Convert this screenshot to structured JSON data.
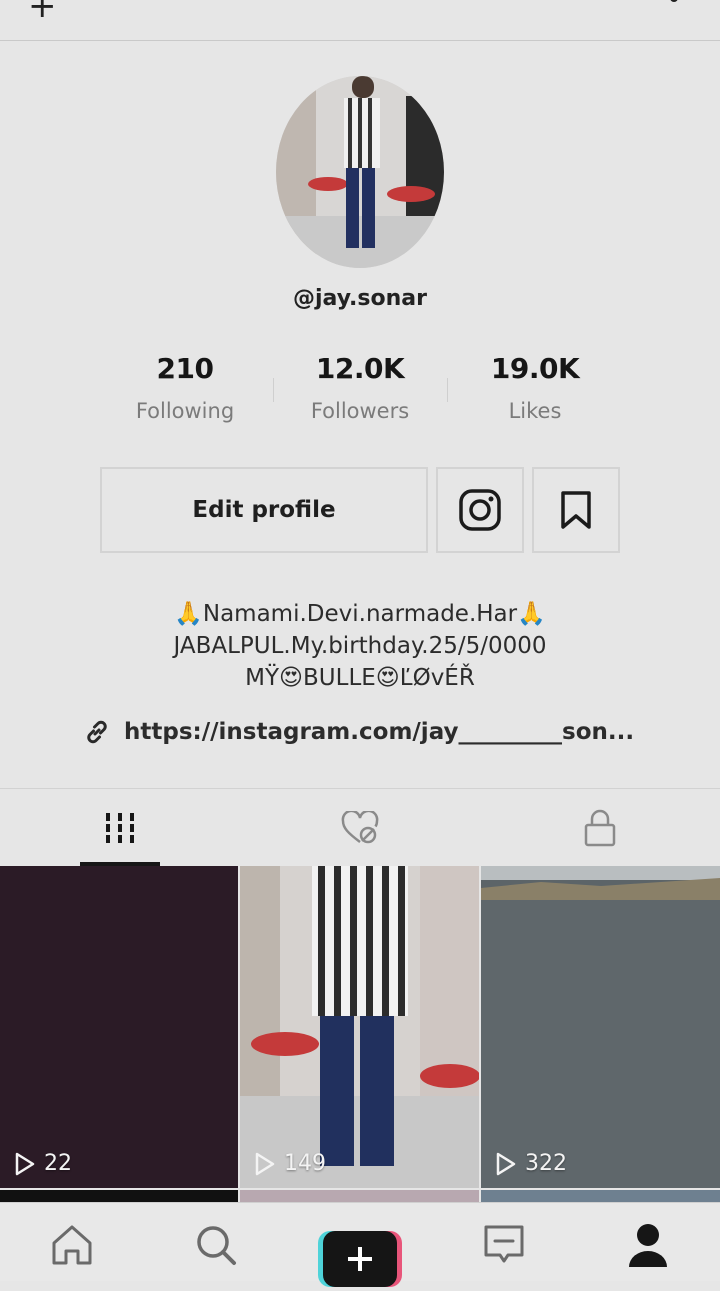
{
  "profile": {
    "username": "@jay.sonar",
    "stats": [
      {
        "value": "210",
        "label": "Following"
      },
      {
        "value": "12.0K",
        "label": "Followers"
      },
      {
        "value": "19.0K",
        "label": "Likes"
      }
    ],
    "edit_label": "Edit profile",
    "bio_lines": [
      "🙏Namami.Devi.narmade.Har🙏",
      "JABALPUL.My.birthday.25/5/0000",
      "MŸ😍BULLE😍ĽØvÉŘ"
    ],
    "link": "https://instagram.com/jay_________son..."
  },
  "tabs": [
    {
      "name": "videos",
      "icon": "grid-icon",
      "active": true
    },
    {
      "name": "liked",
      "icon": "hidden-heart-icon",
      "active": false
    },
    {
      "name": "private",
      "icon": "lock-icon",
      "active": false
    }
  ],
  "videos": [
    {
      "views": "22",
      "thumb": "dark-purple"
    },
    {
      "views": "149",
      "thumb": "striped-shirt"
    },
    {
      "views": "322",
      "thumb": "river"
    }
  ],
  "bottom_nav": [
    {
      "icon": "home-icon"
    },
    {
      "icon": "search-icon"
    },
    {
      "icon": "create-icon"
    },
    {
      "icon": "inbox-icon"
    },
    {
      "icon": "profile-icon"
    }
  ],
  "colors": {
    "background": "#e6e6e6",
    "text": "#161616",
    "muted": "#7b7b7b",
    "create_cyan": "#4fd3d9",
    "create_pink": "#e8557a"
  }
}
